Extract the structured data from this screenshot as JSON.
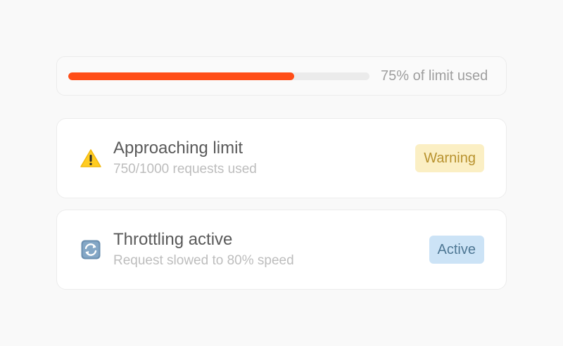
{
  "usage": {
    "fraction": 0.75,
    "label": "75% of limit used",
    "fill_color": "#ff4d17"
  },
  "alerts": [
    {
      "icon": "warning-icon",
      "title": "Approaching limit",
      "subtitle": "750/1000 requests used",
      "badge": "Warning",
      "badge_colors": {
        "bg": "#fbefc4",
        "text": "#b8922e"
      }
    },
    {
      "icon": "refresh-icon",
      "title": "Throttling active",
      "subtitle": "Request slowed to 80% speed",
      "badge": "Active",
      "badge_colors": {
        "bg": "#cce3f6",
        "text": "#4e7794"
      }
    }
  ]
}
